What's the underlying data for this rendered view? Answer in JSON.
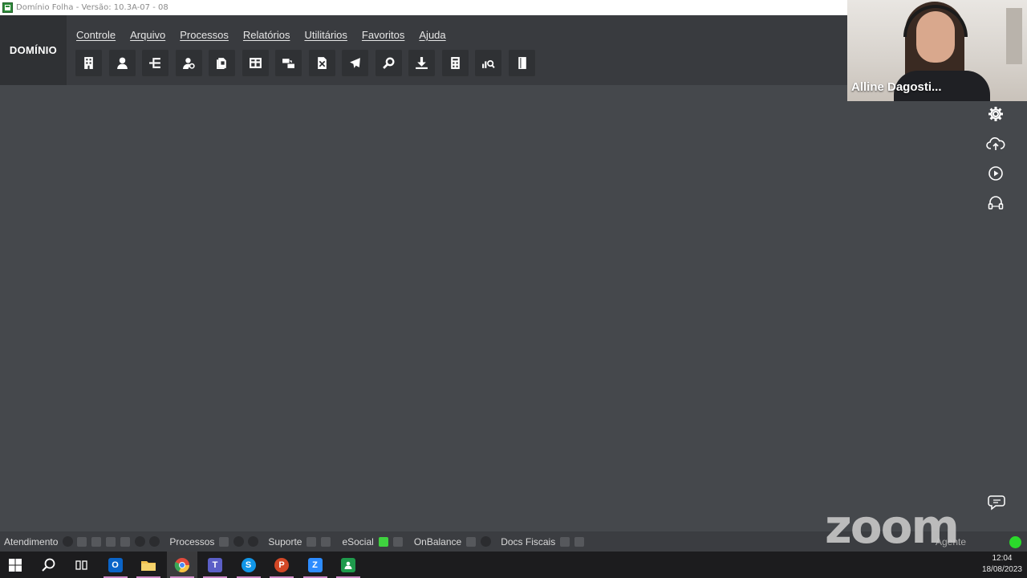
{
  "window": {
    "title": "Domínio Folha - Versão: 10.3A-07 - 08"
  },
  "header": {
    "logo": "DOMÍNIO",
    "menu": [
      {
        "label": "Controle"
      },
      {
        "label": "Arquivo"
      },
      {
        "label": "Processos"
      },
      {
        "label": "Relatórios"
      },
      {
        "label": "Utilitários"
      },
      {
        "label": "Favoritos"
      },
      {
        "label": "Ajuda"
      }
    ],
    "toolbar": [
      {
        "icon": "building-icon"
      },
      {
        "icon": "user-icon"
      },
      {
        "icon": "tree-icon"
      },
      {
        "icon": "user-search-icon"
      },
      {
        "icon": "documents-icon"
      },
      {
        "icon": "spreadsheet-icon"
      },
      {
        "icon": "transfer-icon"
      },
      {
        "icon": "file-x-icon"
      },
      {
        "icon": "airplane-icon"
      },
      {
        "icon": "search-icon"
      },
      {
        "icon": "download-icon"
      },
      {
        "icon": "calculator-icon"
      },
      {
        "icon": "chart-search-icon"
      },
      {
        "icon": "book-icon"
      }
    ]
  },
  "video": {
    "participant_name": "Alline Dagosti..."
  },
  "side_panel": {
    "icons": [
      "gear-icon",
      "cloud-upload-icon",
      "play-icon",
      "headset-icon"
    ],
    "chat_icon": "chat-icon"
  },
  "statusbar": {
    "atendimento": "Atendimento",
    "processos": "Processos",
    "suporte": "Suporte",
    "esocial": "eSocial",
    "onbalance": "OnBalance",
    "docs_fiscais": "Docs Fiscais",
    "agente": "Agente"
  },
  "overlay": {
    "zoom_logo": "zoom"
  },
  "taskbar": {
    "apps": [
      {
        "icon": "windows-start-icon"
      },
      {
        "icon": "search-icon"
      },
      {
        "icon": "task-view-icon"
      },
      {
        "icon": "outlook-icon",
        "letter": "O",
        "color": "#0a64c8"
      },
      {
        "icon": "file-explorer-icon",
        "color": "#f2c14e"
      },
      {
        "icon": "chrome-icon",
        "color": "#e04a3c"
      },
      {
        "icon": "teams-icon",
        "letter": "T",
        "color": "#5b5fc7"
      },
      {
        "icon": "skype-icon",
        "letter": "S",
        "color": "#1196e8"
      },
      {
        "icon": "powerpoint-icon",
        "letter": "P",
        "color": "#d24726"
      },
      {
        "icon": "zoom-icon",
        "letter": "Z",
        "color": "#2d8cff"
      },
      {
        "icon": "dominio-icon",
        "color": "#1f9a4c"
      }
    ],
    "time": "12:04",
    "date": "18/08/2023"
  }
}
